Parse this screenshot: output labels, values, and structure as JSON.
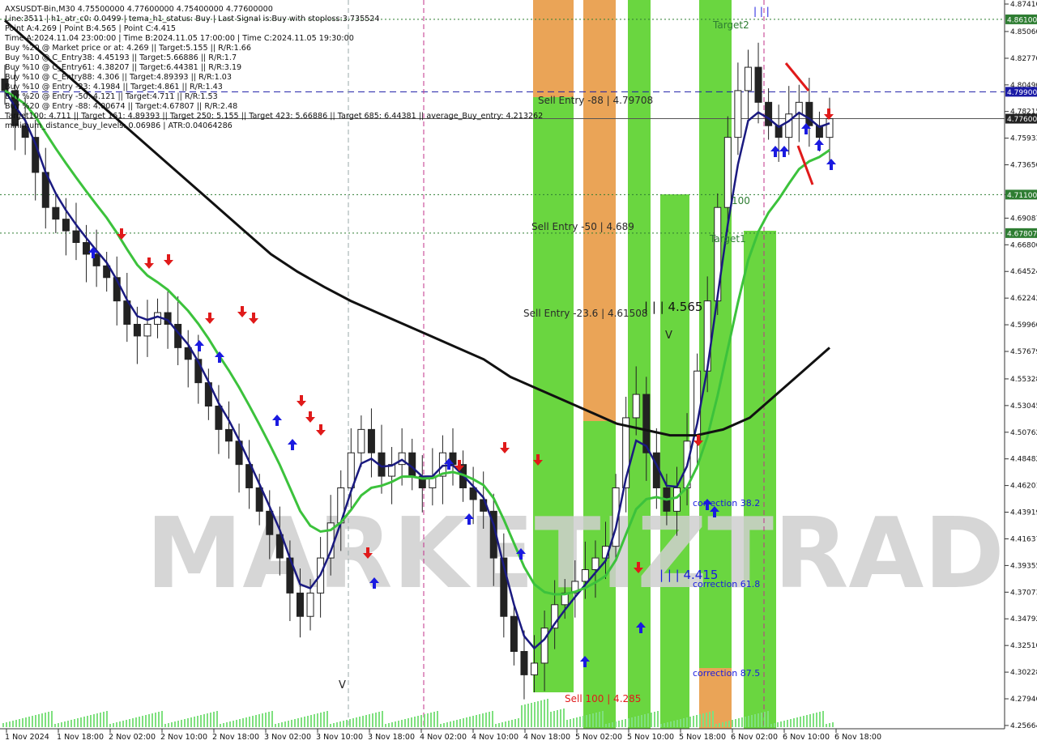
{
  "header": {
    "symbol_line": "AXSUSDT-Bin,M30  4.75500000 4.77600000 4.75400000 4.77600000",
    "info_lines": [
      "Line:3511 | h1_atr_c0: 0.0499 | tema_h1_status: Buy | Last Signal is:Buy with stoploss:3.735524",
      "Point A:4.269 | Point B:4.565 | Point C:4.415",
      "Time A:2024.11.04 23:00:00 | Time B:2024.11.05 17:00:00 | Time C:2024.11.05 19:30:00",
      "Buy %20 @ Market price or at: 4.269 || Target:5.155 || R/R:1.66",
      "Buy %10 @ C_Entry38: 4.45193 || Target:5.66886 || R/R:1.7",
      "Buy %10 @ C_Entry61: 4.38207 || Target:6.44381 || R/R:3.19",
      "Buy %10 @ C_Entry88: 4.306 || Target:4.89393 || R/R:1.03",
      "Buy %10 @ Entry -23: 4.1984 || Target:4.861 || R/R:1.43",
      "Buy %20 @ Entry -50: 4.121 || Target:4.711 || R/R:1.53",
      "Buy %20 @ Entry -88: 4.00674 || Target:4.67807 || R/R:2.48",
      "Target100: 4.711 || Target 161: 4.89393 || Target 250: 5.155 || Target 423: 5.66886 || Target 685: 6.44381 || average_Buy_entry: 4.213262",
      "minimum_distance_buy_levels: 0.06986 | ATR:0.04064286"
    ]
  },
  "watermark": "MARKETIZTRADE",
  "price_axis": {
    "ticks": [
      "4.87410",
      "4.85060",
      "4.82770",
      "4.80490",
      "4.78215",
      "4.75933",
      "4.73650",
      "4.71100",
      "4.69087",
      "4.66806",
      "4.64524",
      "4.62242",
      "4.59960",
      "4.57679",
      "4.55328",
      "4.53045",
      "4.50762",
      "4.48482",
      "4.46201",
      "4.43919",
      "4.41637",
      "4.39355",
      "4.37073",
      "4.34792",
      "4.32510",
      "4.30228",
      "4.27946",
      "4.25664"
    ],
    "badges": [
      {
        "label": "4.86100",
        "value": 4.861,
        "color": "#2e7d32"
      },
      {
        "label": "4.79900",
        "value": 4.799,
        "color": "#1a1aa6"
      },
      {
        "label": "4.77600",
        "value": 4.776,
        "color": "#222222"
      },
      {
        "label": "4.71100",
        "value": 4.711,
        "color": "#2e7d32"
      },
      {
        "label": "4.67807",
        "value": 4.67807,
        "color": "#2e7d32"
      }
    ]
  },
  "time_axis": {
    "ticks": [
      "1 Nov 2024",
      "1 Nov 18:00",
      "2 Nov 02:00",
      "2 Nov 10:00",
      "2 Nov 18:00",
      "3 Nov 02:00",
      "3 Nov 10:00",
      "3 Nov 18:00",
      "4 Nov 02:00",
      "4 Nov 10:00",
      "4 Nov 18:00",
      "5 Nov 02:00",
      "5 Nov 10:00",
      "5 Nov 18:00",
      "6 Nov 02:00",
      "6 Nov 10:00",
      "6 Nov 18:00"
    ]
  },
  "annotations": {
    "target2": "Target2",
    "target1": "Target1",
    "sell_entry_88": "Sell Entry -88 | 4.79708",
    "sell_entry_50": "Sell Entry -50 | 4.689",
    "sell_entry_23": "Sell Entry -23.6 | 4.61508",
    "sell_100": "Sell 100 | 4.285",
    "point_b": "| | | 4.565",
    "point_c": "| | | 4.415",
    "correction_38": "correction 38.2",
    "correction_61": "correction 61.8",
    "correction_87": "correction 87.5",
    "label_100": "100",
    "v_marker": "V",
    "down_arrow": "V"
  },
  "chart_data": {
    "type": "candlestick",
    "symbol": "AXSUSDT-Bin",
    "timeframe": "M30",
    "ohlc_last": {
      "open": 4.755,
      "high": 4.776,
      "low": 4.754,
      "close": 4.776
    },
    "ylim": [
      4.2566,
      4.8741
    ],
    "horizontal_levels": [
      {
        "value": 4.861,
        "style": "dotted",
        "color": "#2e7d32"
      },
      {
        "value": 4.799,
        "style": "dashed",
        "color": "#1a1aa6"
      },
      {
        "value": 4.776,
        "style": "solid",
        "color": "#555555"
      },
      {
        "value": 4.711,
        "style": "dotted",
        "color": "#2e7d32"
      },
      {
        "value": 4.67807,
        "style": "dotted",
        "color": "#2e7d32"
      }
    ],
    "close_series_approx": [
      4.8,
      4.77,
      4.76,
      4.73,
      4.7,
      4.69,
      4.68,
      4.67,
      4.66,
      4.65,
      4.64,
      4.62,
      4.6,
      4.59,
      4.6,
      4.61,
      4.6,
      4.58,
      4.57,
      4.55,
      4.53,
      4.51,
      4.5,
      4.48,
      4.46,
      4.44,
      4.42,
      4.4,
      4.37,
      4.35,
      4.37,
      4.4,
      4.43,
      4.46,
      4.49,
      4.51,
      4.49,
      4.47,
      4.48,
      4.49,
      4.47,
      4.46,
      4.47,
      4.49,
      4.48,
      4.46,
      4.45,
      4.44,
      4.4,
      4.35,
      4.32,
      4.3,
      4.31,
      4.34,
      4.36,
      4.37,
      4.38,
      4.39,
      4.4,
      4.41,
      4.46,
      4.52,
      4.54,
      4.49,
      4.46,
      4.44,
      4.46,
      4.5,
      4.56,
      4.62,
      4.7,
      4.76,
      4.8,
      4.82,
      4.79,
      4.77,
      4.76,
      4.78,
      4.79,
      4.77,
      4.76,
      4.776
    ],
    "ma_slow_approx": [
      4.86,
      4.84,
      4.82,
      4.8,
      4.78,
      4.76,
      4.74,
      4.72,
      4.7,
      4.68,
      4.66,
      4.645,
      4.632,
      4.62,
      4.61,
      4.6,
      4.59,
      4.58,
      4.57,
      4.555,
      4.545,
      4.535,
      4.525,
      4.515,
      4.51,
      4.505,
      4.505,
      4.51,
      4.52,
      4.54,
      4.56,
      4.58
    ],
    "vertical_markers": [
      "2 Nov 18:00 (approx)",
      "4 Nov 02:00 (approx)",
      "6 Nov 02:00 (approx)"
    ]
  },
  "colors": {
    "bull_zone": "#5ad12b",
    "bear_zone": "#e89a45",
    "ma_fast": "#1a1a80",
    "ma_mid": "#3cc23c",
    "ma_slow": "#111111",
    "buy_arrow": "#1a1ae0",
    "sell_arrow": "#e01a1a"
  }
}
